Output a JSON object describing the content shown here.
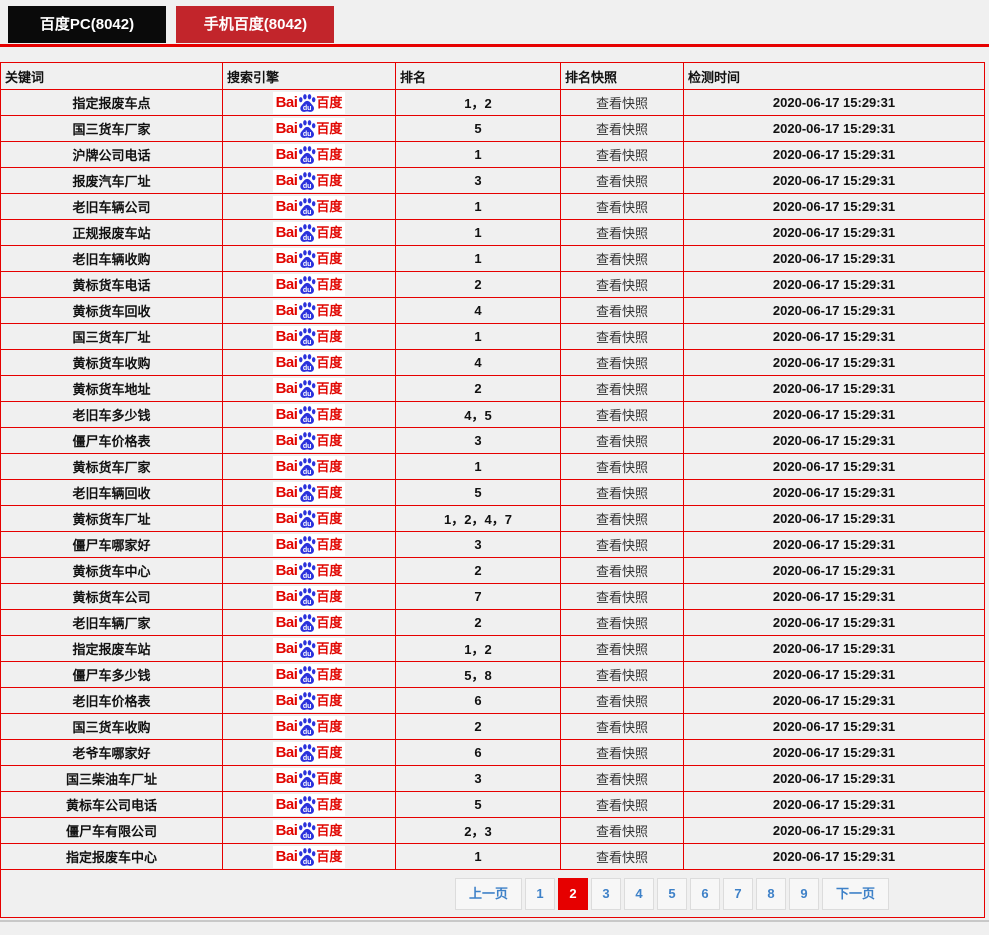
{
  "tabs": [
    {
      "label": "百度PC(8042)"
    },
    {
      "label": "手机百度(8042)"
    }
  ],
  "colors": {
    "tab_pc_bg": "#0a0a0a",
    "tab_mobile_bg": "#c2252b",
    "table_border": "#e60000",
    "active_page_bg": "#e60000",
    "pager_link": "#3e81c8"
  },
  "table": {
    "headers": [
      "关键词",
      "搜索引擎",
      "排名",
      "排名快照",
      "检测时间"
    ],
    "engine_logo": {
      "bai": "Bai",
      "du": "du",
      "suffix": "百度"
    },
    "snapshot_label": "查看快照",
    "rows": [
      {
        "keyword": "指定报废车点",
        "rank": "1，2",
        "time": "2020-06-17 15:29:31"
      },
      {
        "keyword": "国三货车厂家",
        "rank": "5",
        "time": "2020-06-17 15:29:31"
      },
      {
        "keyword": "沪牌公司电话",
        "rank": "1",
        "time": "2020-06-17 15:29:31"
      },
      {
        "keyword": "报废汽车厂址",
        "rank": "3",
        "time": "2020-06-17 15:29:31"
      },
      {
        "keyword": "老旧车辆公司",
        "rank": "1",
        "time": "2020-06-17 15:29:31"
      },
      {
        "keyword": "正规报废车站",
        "rank": "1",
        "time": "2020-06-17 15:29:31"
      },
      {
        "keyword": "老旧车辆收购",
        "rank": "1",
        "time": "2020-06-17 15:29:31"
      },
      {
        "keyword": "黄标货车电话",
        "rank": "2",
        "time": "2020-06-17 15:29:31"
      },
      {
        "keyword": "黄标货车回收",
        "rank": "4",
        "time": "2020-06-17 15:29:31"
      },
      {
        "keyword": "国三货车厂址",
        "rank": "1",
        "time": "2020-06-17 15:29:31"
      },
      {
        "keyword": "黄标货车收购",
        "rank": "4",
        "time": "2020-06-17 15:29:31"
      },
      {
        "keyword": "黄标货车地址",
        "rank": "2",
        "time": "2020-06-17 15:29:31"
      },
      {
        "keyword": "老旧车多少钱",
        "rank": "4，5",
        "time": "2020-06-17 15:29:31"
      },
      {
        "keyword": "僵尸车价格表",
        "rank": "3",
        "time": "2020-06-17 15:29:31"
      },
      {
        "keyword": "黄标货车厂家",
        "rank": "1",
        "time": "2020-06-17 15:29:31"
      },
      {
        "keyword": "老旧车辆回收",
        "rank": "5",
        "time": "2020-06-17 15:29:31"
      },
      {
        "keyword": "黄标货车厂址",
        "rank": "1，2，4，7",
        "time": "2020-06-17 15:29:31"
      },
      {
        "keyword": "僵尸车哪家好",
        "rank": "3",
        "time": "2020-06-17 15:29:31"
      },
      {
        "keyword": "黄标货车中心",
        "rank": "2",
        "time": "2020-06-17 15:29:31"
      },
      {
        "keyword": "黄标货车公司",
        "rank": "7",
        "time": "2020-06-17 15:29:31"
      },
      {
        "keyword": "老旧车辆厂家",
        "rank": "2",
        "time": "2020-06-17 15:29:31"
      },
      {
        "keyword": "指定报废车站",
        "rank": "1，2",
        "time": "2020-06-17 15:29:31"
      },
      {
        "keyword": "僵尸车多少钱",
        "rank": "5，8",
        "time": "2020-06-17 15:29:31"
      },
      {
        "keyword": "老旧车价格表",
        "rank": "6",
        "time": "2020-06-17 15:29:31"
      },
      {
        "keyword": "国三货车收购",
        "rank": "2",
        "time": "2020-06-17 15:29:31"
      },
      {
        "keyword": "老爷车哪家好",
        "rank": "6",
        "time": "2020-06-17 15:29:31"
      },
      {
        "keyword": "国三柴油车厂址",
        "rank": "3",
        "time": "2020-06-17 15:29:31"
      },
      {
        "keyword": "黄标车公司电话",
        "rank": "5",
        "time": "2020-06-17 15:29:31"
      },
      {
        "keyword": "僵尸车有限公司",
        "rank": "2，3",
        "time": "2020-06-17 15:29:31"
      },
      {
        "keyword": "指定报废车中心",
        "rank": "1",
        "time": "2020-06-17 15:29:31"
      }
    ]
  },
  "pagination": {
    "prev": "上一页",
    "pages": [
      "1",
      "2",
      "3",
      "4",
      "5",
      "6",
      "7",
      "8",
      "9"
    ],
    "active": "2",
    "next": "下一页"
  }
}
